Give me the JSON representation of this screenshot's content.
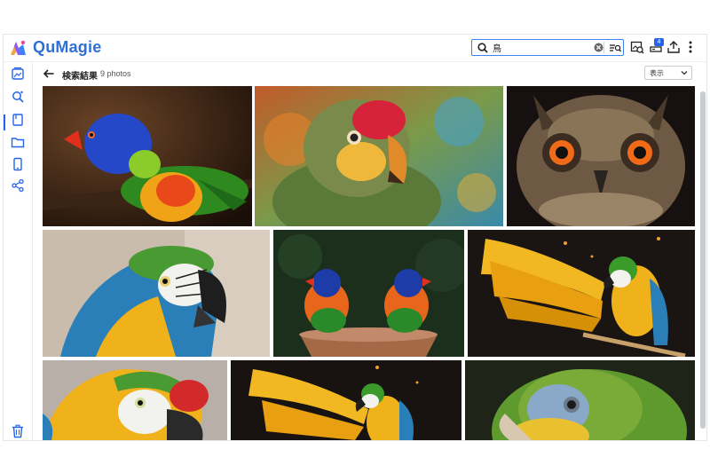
{
  "app": {
    "name": "QuMagie"
  },
  "search": {
    "value": "鳥",
    "placeholder": ""
  },
  "header": {
    "title": "検索結果",
    "count": "9 photos"
  },
  "view": {
    "label": "表示"
  },
  "toolbar": {
    "badge_count": "4"
  },
  "colors": {
    "accent": "#2563eb",
    "brand": "#2f6fd6"
  },
  "sidebar": {
    "items": [
      {
        "icon": "photos-icon"
      },
      {
        "icon": "smart-search-icon",
        "active": true
      },
      {
        "icon": "album-icon"
      },
      {
        "icon": "folder-icon"
      },
      {
        "icon": "device-icon"
      },
      {
        "icon": "share-icon"
      }
    ],
    "bottom": {
      "icon": "trash-icon"
    }
  },
  "photos": [
    {
      "subject": "rainbow lorikeet"
    },
    {
      "subject": "parrot head"
    },
    {
      "subject": "owl"
    },
    {
      "subject": "blue and yellow macaw"
    },
    {
      "subject": "two lorikeets on bowl"
    },
    {
      "subject": "macaw spreading wings"
    },
    {
      "subject": "macaw close-up"
    },
    {
      "subject": "macaw with wings"
    },
    {
      "subject": "green amazon parrot"
    }
  ]
}
